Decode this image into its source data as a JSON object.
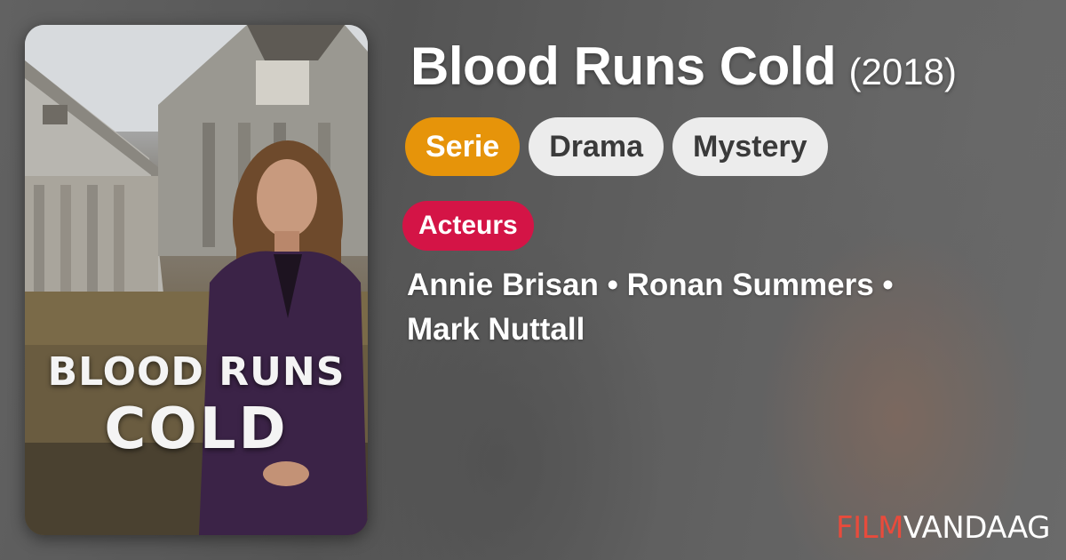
{
  "poster": {
    "title_line1": "BLOOD RUNS",
    "title_line2": "COLD"
  },
  "show": {
    "title": "Blood Runs Cold",
    "year": "(2018)"
  },
  "tags": {
    "type": "Serie",
    "genres": [
      "Drama",
      "Mystery"
    ]
  },
  "cast": {
    "label": "Acteurs",
    "names_line1": "Annie Brisan • Ronan Summers •",
    "names_line2": "Mark Nuttall"
  },
  "brand": {
    "part1": "FILM",
    "part2": "VANDAAG"
  },
  "colors": {
    "type_tag": "#e6940a",
    "genre_tag": "#ececec",
    "cast_badge": "#d41446",
    "brand_accent": "#e84b3c"
  }
}
